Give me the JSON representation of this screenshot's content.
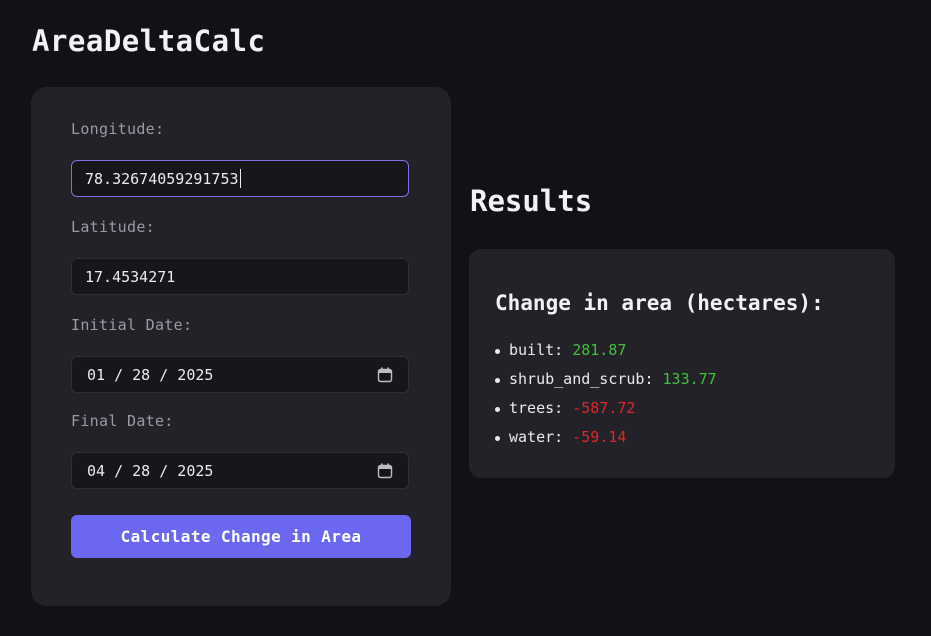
{
  "app": {
    "title": "AreaDeltaCalc"
  },
  "form": {
    "longitude_label": "Longitude:",
    "longitude_value": "78.32674059291753",
    "latitude_label": "Latitude:",
    "latitude_value": "17.4534271",
    "initial_date_label": "Initial Date:",
    "initial_date_value": "01/28/2025",
    "final_date_label": "Final Date:",
    "final_date_value": "04/28/2025",
    "submit_label": "Calculate Change in Area"
  },
  "results": {
    "heading": "Results",
    "subheading": "Change in area (hectares):",
    "items": [
      {
        "label": "built:",
        "value": "281.87",
        "sign": "positive"
      },
      {
        "label": "shrub_and_scrub:",
        "value": "133.77",
        "sign": "positive"
      },
      {
        "label": "trees:",
        "value": "-587.72",
        "sign": "negative"
      },
      {
        "label": "water:",
        "value": "-59.14",
        "sign": "negative"
      }
    ]
  },
  "colors": {
    "accent": "#6b67f0",
    "positive": "#3fc13f",
    "negative": "#e0262b",
    "background": "#121117",
    "card": "#232228"
  },
  "icons": {
    "date_picker": "calendar-icon"
  }
}
